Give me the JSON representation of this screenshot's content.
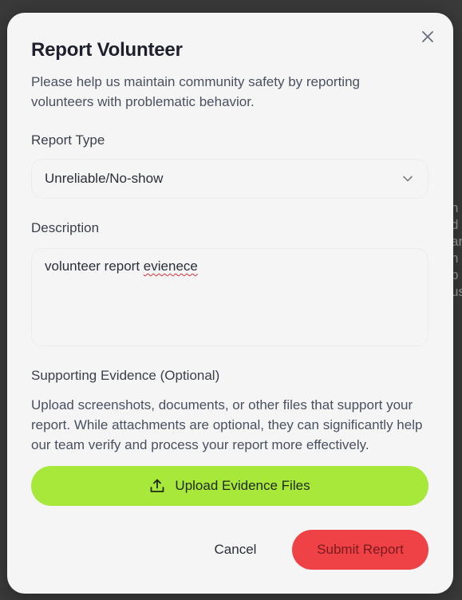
{
  "backdrop": {
    "fragments": "h\nd\nar\nn\np\nus"
  },
  "modal": {
    "title": "Report Volunteer",
    "subtitle": "Please help us maintain community safety by reporting volunteers with problematic behavior.",
    "close_icon": "close-icon"
  },
  "report_type": {
    "label": "Report Type",
    "selected": "Unreliable/No-show",
    "chevron_icon": "chevron-down-icon"
  },
  "description": {
    "label": "Description",
    "value_prefix": "volunteer report ",
    "value_misspelled": "evienece"
  },
  "evidence": {
    "label": "Supporting Evidence (Optional)",
    "help_text": "Upload screenshots, documents, or other files that support your report. While attachments are optional, they can significantly help our team verify and process your report more effectively.",
    "upload_label": "Upload Evidence Files",
    "upload_icon": "upload-icon"
  },
  "actions": {
    "cancel_label": "Cancel",
    "submit_label": "Submit Report"
  },
  "colors": {
    "upload_button": "#a7e83a",
    "submit_button": "#ef4246",
    "modal_background": "#f5f5f5"
  }
}
